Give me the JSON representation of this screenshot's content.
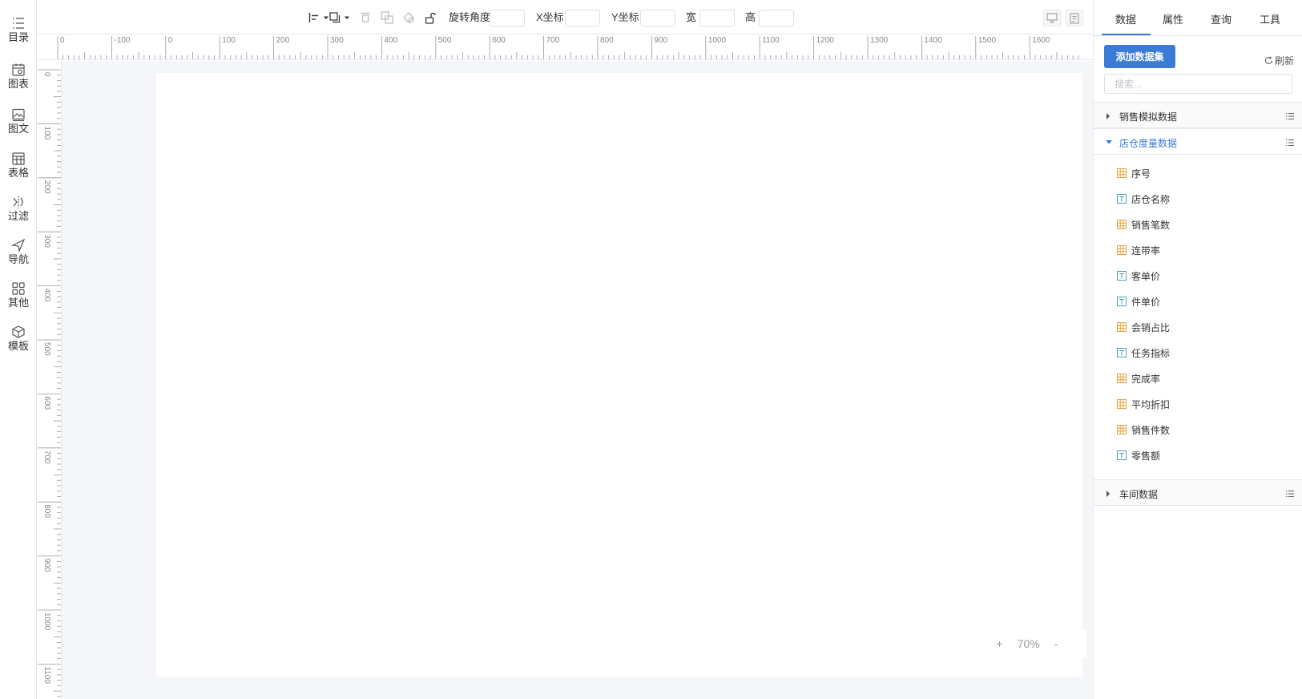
{
  "sidebar": {
    "items": [
      {
        "label": "目录",
        "icon": "list-icon"
      },
      {
        "label": "图表",
        "icon": "chart-calendar-icon"
      },
      {
        "label": "图文",
        "icon": "image-text-icon"
      },
      {
        "label": "表格",
        "icon": "table-icon"
      },
      {
        "label": "过滤",
        "icon": "filter-icon"
      },
      {
        "label": "导航",
        "icon": "navigation-icon"
      },
      {
        "label": "其他",
        "icon": "grid-icon"
      },
      {
        "label": "模板",
        "icon": "template-icon"
      }
    ]
  },
  "toolbar": {
    "rotate_label": "旋转角度",
    "x_label": "X坐标",
    "y_label": "Y坐标",
    "width_label": "宽",
    "height_label": "高",
    "rotate_value": "",
    "x_value": "",
    "y_value": "",
    "width_value": "",
    "height_value": ""
  },
  "ruler": {
    "h_labels": [
      "0",
      "-100",
      "0",
      "100",
      "200",
      "300",
      "400",
      "500",
      "600",
      "700",
      "800",
      "900",
      "1000",
      "1100",
      "1200",
      "1300",
      "1400",
      "1500",
      "1600"
    ],
    "v_labels": [
      "0",
      "100",
      "200",
      "300",
      "400",
      "500",
      "600",
      "700",
      "800",
      "900",
      "1000",
      "1100"
    ]
  },
  "zoom": {
    "plus": "+",
    "value": "70%",
    "minus": "-"
  },
  "panel": {
    "tabs": [
      "数据",
      "属性",
      "查询",
      "工具"
    ],
    "active_tab": "数据",
    "add_dataset_label": "添加数据集",
    "refresh_label": "刷新",
    "search_placeholder": "搜索...",
    "groups": [
      {
        "title": "销售模拟数据",
        "expanded": false
      },
      {
        "title": "店仓度量数据",
        "expanded": true
      },
      {
        "title": "车间数据",
        "expanded": false
      }
    ],
    "fields": [
      {
        "name": "序号",
        "type": "number"
      },
      {
        "name": "店仓名称",
        "type": "text"
      },
      {
        "name": "销售笔数",
        "type": "number"
      },
      {
        "name": "连带率",
        "type": "number"
      },
      {
        "name": "客单价",
        "type": "text"
      },
      {
        "name": "件单价",
        "type": "text"
      },
      {
        "name": "会销占比",
        "type": "number"
      },
      {
        "name": "任务指标",
        "type": "text"
      },
      {
        "name": "完成率",
        "type": "number"
      },
      {
        "name": "平均折扣",
        "type": "number"
      },
      {
        "name": "销售件数",
        "type": "number"
      },
      {
        "name": "零售额",
        "type": "text"
      }
    ]
  },
  "colors": {
    "accent": "#3a7bd5",
    "number_field": "#e6a23c",
    "text_field": "#4aa3b8"
  }
}
